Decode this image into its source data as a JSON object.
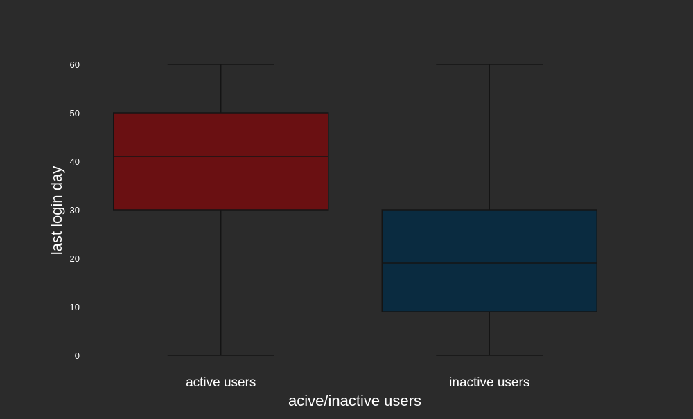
{
  "chart_data": {
    "type": "box",
    "xlabel": "acive/inactive users",
    "ylabel": "last login day",
    "categories": [
      "active users",
      "inactive users"
    ],
    "ylim": [
      -3,
      63
    ],
    "yticks": [
      0,
      10,
      20,
      30,
      40,
      50,
      60
    ],
    "grid": false,
    "boxes": [
      {
        "category": "active users",
        "min": 0,
        "q1": 30,
        "median": 41,
        "q3": 50,
        "max": 60,
        "color": "#6a1012"
      },
      {
        "category": "inactive users",
        "min": 0,
        "q1": 9,
        "median": 19,
        "q3": 30,
        "max": 60,
        "color": "#0a2b40"
      }
    ],
    "colors": {
      "background": "#2b2b2b",
      "text": "#ffffff",
      "line": "#141414"
    }
  }
}
